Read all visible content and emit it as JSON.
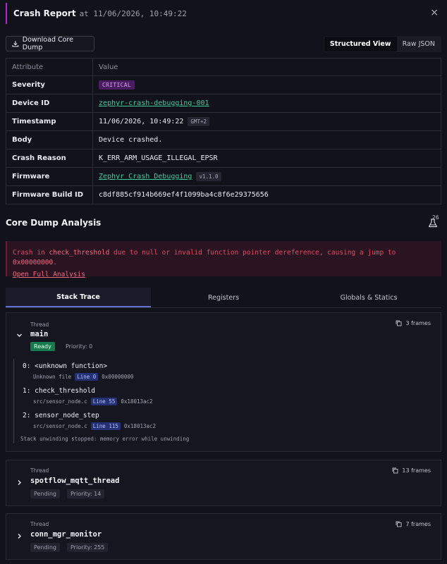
{
  "header": {
    "title": "Crash Report",
    "timestamp": "at 11/06/2026, 10:49:22",
    "close_glyph": "×"
  },
  "toolbar": {
    "download_label": "Download Core Dump",
    "views": [
      "Structured View",
      "Raw JSON"
    ],
    "active_view": "Structured View"
  },
  "table": {
    "col_attribute": "Attribute",
    "col_value": "Value",
    "severity": {
      "key": "Severity",
      "value": "CRITICAL"
    },
    "device": {
      "key": "Device ID",
      "value": "zephyr-crash-debugging-001"
    },
    "timestamp": {
      "key": "Timestamp",
      "value": "11/06/2026, 10:49:22",
      "tz": "GMT+2"
    },
    "body": {
      "key": "Body",
      "value": "Device crashed."
    },
    "reason": {
      "key": "Crash Reason",
      "value": "K_ERR_ARM_USAGE_ILLEGAL_EPSR"
    },
    "firmware": {
      "key": "Firmware",
      "value": "Zephyr Crash Debugging",
      "version": "v1.1.0"
    },
    "build": {
      "key": "Firmware Build ID",
      "value": "c8df885cf914b669ef4f1099ba4c8f6e29375656"
    }
  },
  "core_dump": {
    "title": "Core Dump Analysis",
    "count": "26",
    "analysis": {
      "prefix": "Crash in",
      "function": "check_threshold",
      "middle": "due to null or invalid function pointer dereference, causing a jump to",
      "address": "0x00000000",
      "suffix": ".",
      "link": "Open Full Analysis"
    }
  },
  "tabs": [
    "Stack Trace",
    "Registers",
    "Globals & Statics"
  ],
  "threads": [
    {
      "label": "Thread",
      "name": "main",
      "status": "Ready",
      "priority": "Priority: 0",
      "frames": "3 frames",
      "stack": [
        {
          "title": "0: <unknown function>",
          "file": "Unknown file",
          "line": "Line 0",
          "addr": "0x00000000"
        },
        {
          "title": "1: check_threshold",
          "file": "src/sensor_node.c",
          "line": "Line 55",
          "addr": "0x18013ac2"
        },
        {
          "title": "2: sensor_node_step",
          "file": "src/sensor_node.c",
          "line": "Line 115",
          "addr": "0x18013ac2"
        }
      ],
      "unwind": "Stack unwinding stopped: memory error while unwinding"
    },
    {
      "label": "Thread",
      "name": "spotflow_mqtt_thread",
      "status": "Pending",
      "priority": "Priority: 14",
      "frames": "13 frames"
    },
    {
      "label": "Thread",
      "name": "conn_mgr_monitor",
      "status": "Pending",
      "priority": "Priority: 255",
      "frames": "7 frames"
    }
  ],
  "colors": {
    "accent": "#a230c9",
    "link": "#3fcf9a",
    "critical": "#4a1c60",
    "ready": "#177a4c",
    "error_text": "#e24a63",
    "tab_indicator": "#6272d8"
  }
}
